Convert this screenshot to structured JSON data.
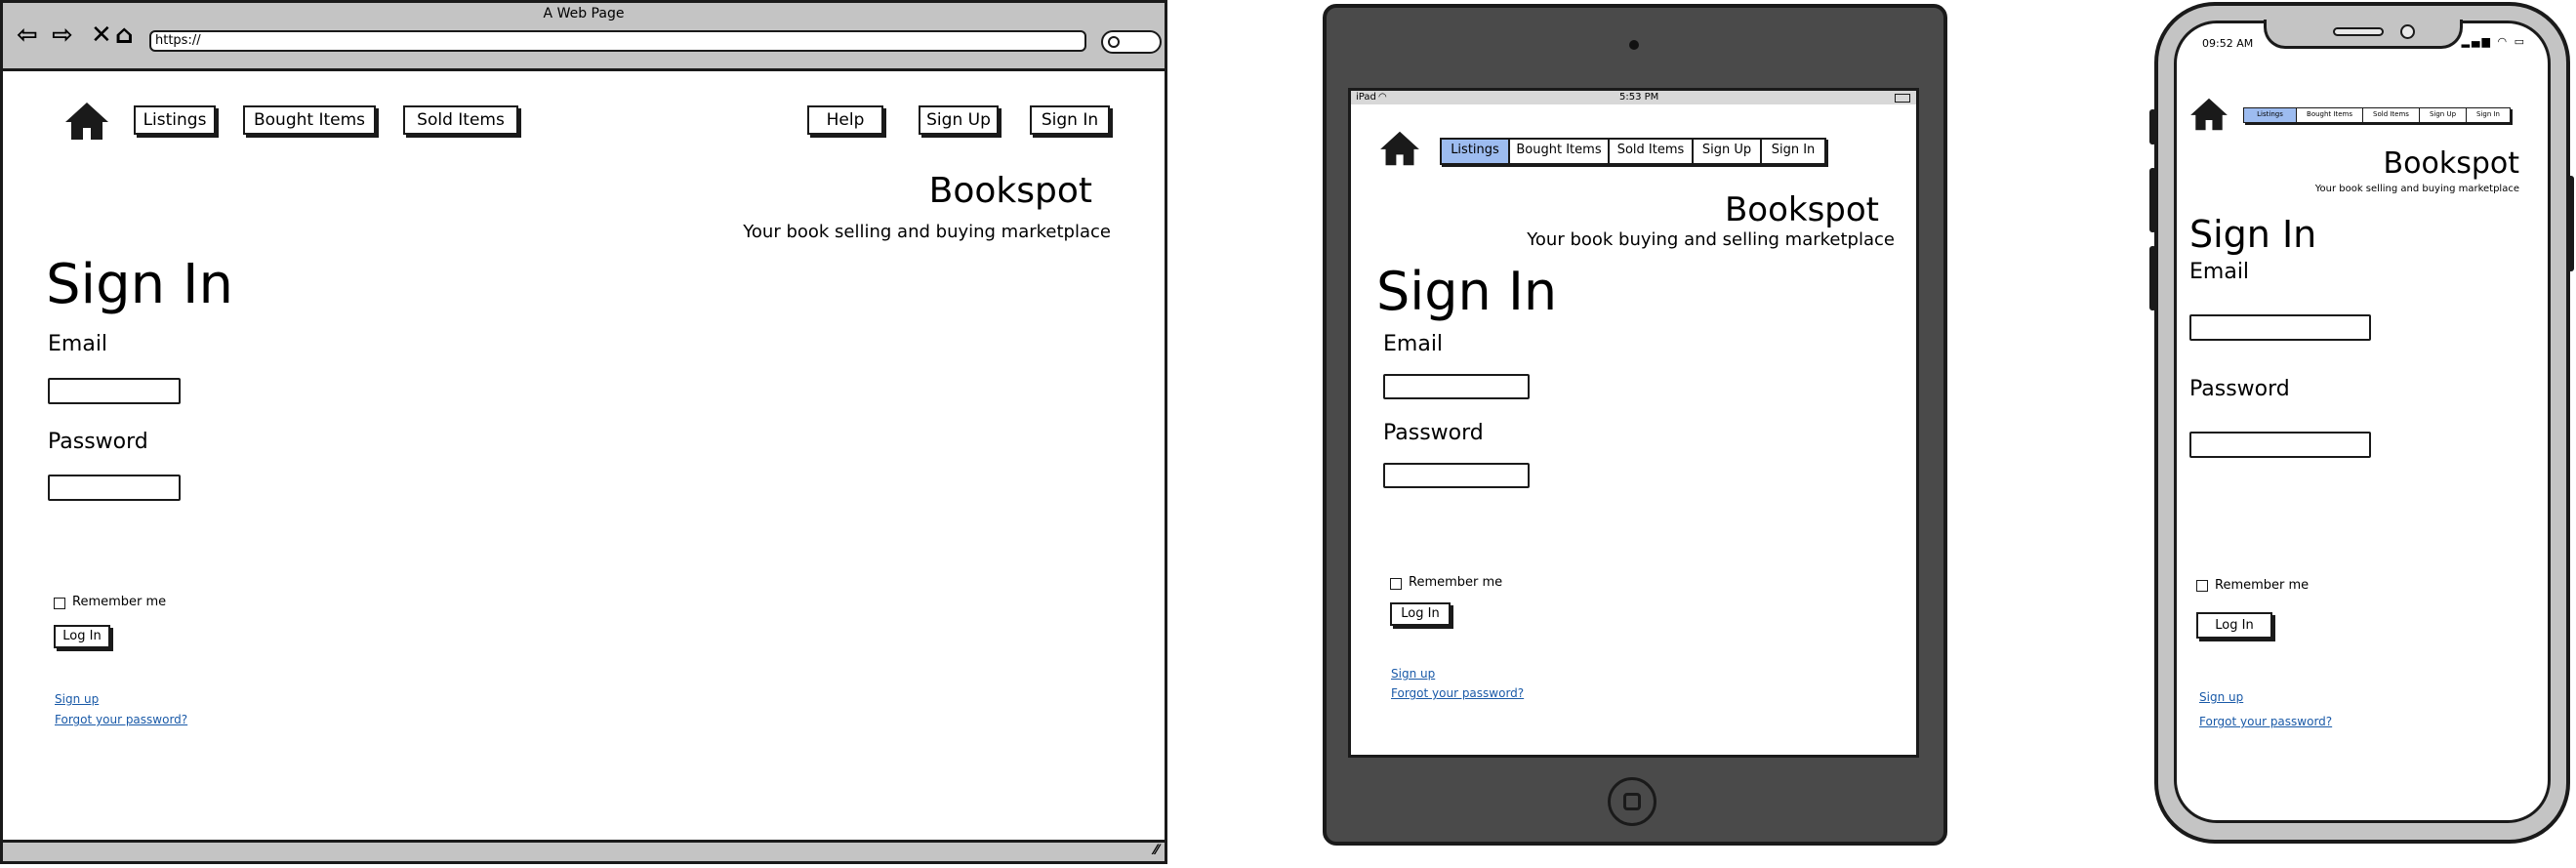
{
  "desktop": {
    "window_title": "A Web Page",
    "url": "https://",
    "nav": {
      "listings": "Listings",
      "bought_items": "Bought Items",
      "sold_items": "Sold Items",
      "help": "Help",
      "sign_up": "Sign Up",
      "sign_in": "Sign In"
    },
    "brand": "Bookspot",
    "tagline": "Your book selling and buying marketplace",
    "heading": "Sign In",
    "email_label": "Email",
    "password_label": "Password",
    "remember_label": "Remember me",
    "login_button": "Log In",
    "signup_link": "Sign up",
    "forgot_link": "Forgot your password?"
  },
  "tablet": {
    "status": {
      "device": "iPad",
      "time": "5:53 PM"
    },
    "nav": {
      "listings": "Listings",
      "bought_items": "Bought Items",
      "sold_items": "Sold Items",
      "sign_up": "Sign Up",
      "sign_in": "Sign In"
    },
    "active_tab": "Listings",
    "brand": "Bookspot",
    "tagline": "Your book buying and selling marketplace",
    "heading": "Sign In",
    "email_label": "Email",
    "password_label": "Password",
    "remember_label": "Remember me",
    "login_button": "Log In",
    "signup_link": "Sign up",
    "forgot_link": "Forgot your password?"
  },
  "phone": {
    "status": {
      "time": "09:52 AM"
    },
    "nav": {
      "listings": "Listings",
      "bought_items": "Bought Items",
      "sold_items": "Sold Items",
      "sign_up": "Sign Up",
      "sign_in": "Sign In"
    },
    "active_tab": "Listings",
    "brand": "Bookspot",
    "tagline": "Your book selling and buying marketplace",
    "heading": "Sign In",
    "email_label": "Email",
    "password_label": "Password",
    "remember_label": "Remember me",
    "login_button": "Log In",
    "signup_link": "Sign up",
    "forgot_link": "Forgot your password?"
  },
  "colors": {
    "chrome_gray": "#c4c4c4",
    "tablet_body": "#4a4a4a",
    "active_tab": "#9dbcf0",
    "link": "#1a5aa8"
  }
}
